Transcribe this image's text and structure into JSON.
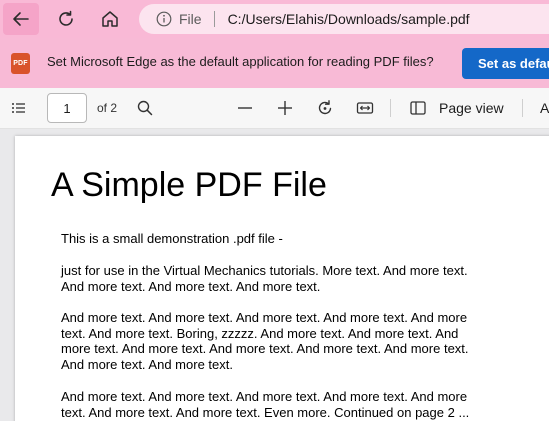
{
  "colors": {
    "nav_background": "#f9b9d6",
    "infobar_background": "#f8bad6",
    "primary_button": "#1468c8",
    "pdf_badge": "#d9532b"
  },
  "nav": {
    "back_icon": "arrow-left-icon",
    "refresh_icon": "refresh-icon",
    "home_icon": "home-icon"
  },
  "address_bar": {
    "scheme": "File",
    "url": "C:/Users/Elahis/Downloads/sample.pdf"
  },
  "infobar": {
    "badge": "PDF",
    "message": "Set Microsoft Edge as the default application for reading PDF files?",
    "button_label": "Set as default"
  },
  "pdf_toolbar": {
    "page_number": "1",
    "page_of": "of 2",
    "page_view_label": "Page view",
    "cut_label": "A"
  },
  "document": {
    "title": "A Simple PDF File",
    "paragraphs": [
      "This is a small demonstration .pdf file -",
      "just for use in the Virtual Mechanics tutorials. More text. And more text. And more text. And more text. And more text.",
      "And more text. And more text. And more text. And more text. And more text. And more text. Boring, zzzzz. And more text. And more text. And more text. And more text. And more text. And more text. And more text. And more text. And more text.",
      "And more text. And more text. And more text. And more text. And more text. And more text. And more text. Even more. Continued on page 2 ..."
    ]
  }
}
